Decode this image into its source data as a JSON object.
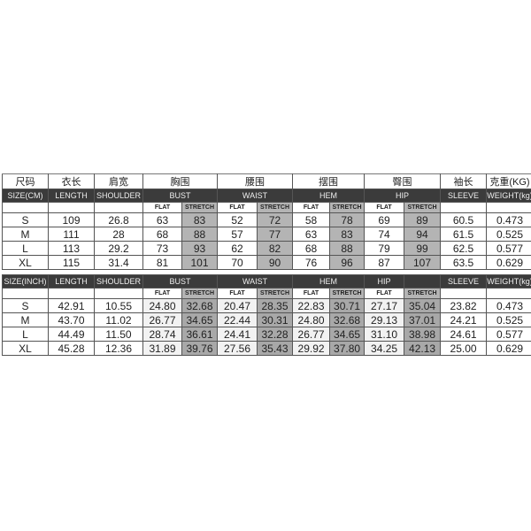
{
  "cn_headers": [
    "尺码",
    "衣长",
    "肩宽",
    "胸围",
    "腰围",
    "摆围",
    "臀围",
    "袖长",
    "克重(KG)"
  ],
  "cm_table": {
    "headers": [
      "SIZE(CM)",
      "LENGTH",
      "SHOULDER",
      "BUST",
      "WAIST",
      "HEM",
      "HIP",
      "SLEEVE",
      "WEIGHT(kg)"
    ],
    "sub": {
      "flat": "FLAT",
      "stretch": "STRETCH"
    },
    "rows": [
      [
        "S",
        "109",
        "26.8",
        "63",
        "83",
        "52",
        "72",
        "58",
        "78",
        "69",
        "89",
        "60.5",
        "0.473"
      ],
      [
        "M",
        "111",
        "28",
        "68",
        "88",
        "57",
        "77",
        "63",
        "83",
        "74",
        "94",
        "61.5",
        "0.525"
      ],
      [
        "L",
        "113",
        "29.2",
        "73",
        "93",
        "62",
        "82",
        "68",
        "88",
        "79",
        "99",
        "62.5",
        "0.577"
      ],
      [
        "XL",
        "115",
        "31.4",
        "81",
        "101",
        "70",
        "90",
        "76",
        "96",
        "87",
        "107",
        "63.5",
        "0.629"
      ]
    ]
  },
  "inch_table": {
    "headers": [
      "SIZE(INCH)",
      "LENGTH",
      "SHOULDER",
      "BUST",
      "WAIST",
      "HEM",
      "HIP",
      "SLEEVE",
      "WEIGHT(kg)"
    ],
    "sub": {
      "flat": "FLAT",
      "stretch": "STRETCH"
    },
    "rows": [
      [
        "S",
        "42.91",
        "10.55",
        "24.80",
        "32.68",
        "20.47",
        "28.35",
        "22.83",
        "30.71",
        "27.17",
        "35.04",
        "23.82",
        "0.473"
      ],
      [
        "M",
        "43.70",
        "11.02",
        "26.77",
        "34.65",
        "22.44",
        "30.31",
        "24.80",
        "32.68",
        "29.13",
        "37.01",
        "24.21",
        "0.525"
      ],
      [
        "L",
        "44.49",
        "11.50",
        "28.74",
        "36.61",
        "24.41",
        "32.28",
        "26.77",
        "34.65",
        "31.10",
        "38.98",
        "24.61",
        "0.577"
      ],
      [
        "XL",
        "45.28",
        "12.36",
        "31.89",
        "39.76",
        "27.56",
        "35.43",
        "29.92",
        "37.80",
        "34.25",
        "42.13",
        "25.00",
        "0.629"
      ]
    ]
  },
  "colors": {
    "header_dark": "#3b3b3b",
    "stretch_shade": "#b4b4b4"
  }
}
